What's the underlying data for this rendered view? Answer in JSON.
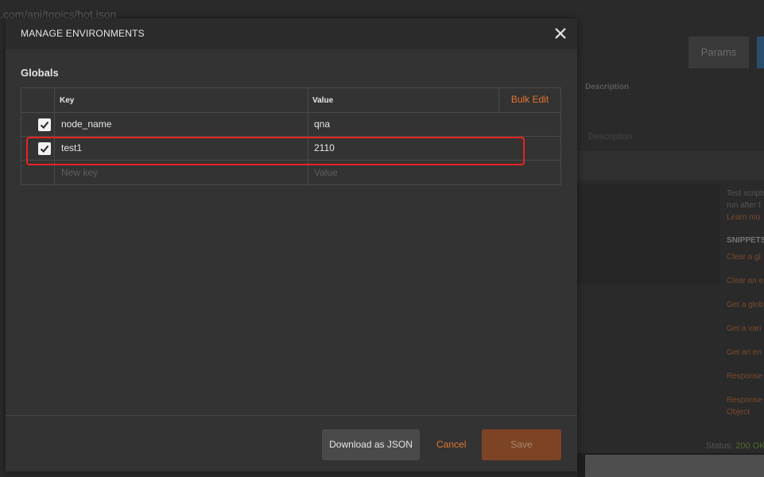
{
  "background": {
    "url": ".com/api/topics/hot.json",
    "params_label": "Params",
    "description_header": "Description",
    "description_placeholder": "Description",
    "sidebar_lines": [
      "Test scripts",
      "run after t",
      "Learn mo"
    ],
    "snippets_label": "SNIPPETS",
    "snippet_links": [
      "Clear a gl",
      "Clear an e",
      "Get a glob",
      "Get a vari",
      "Get an en",
      "Response",
      "Response Object"
    ],
    "status_label": "Status:",
    "status_value": "200 OK"
  },
  "modal": {
    "title": "MANAGE ENVIRONMENTS",
    "close_icon": "close-icon",
    "section_title": "Globals",
    "table": {
      "header_key": "Key",
      "header_value": "Value",
      "bulk_edit_label": "Bulk Edit",
      "rows": [
        {
          "enabled": true,
          "key": "node_name",
          "value": "qna"
        },
        {
          "enabled": true,
          "key": "test1",
          "value": "2110"
        }
      ],
      "new_key_placeholder": "New key",
      "new_value_placeholder": "Value"
    },
    "footer": {
      "download_label": "Download as JSON",
      "cancel_label": "Cancel",
      "save_label": "Save"
    }
  },
  "colors": {
    "accent": "#e3742f",
    "save_bg": "#7d4325",
    "highlight": "#e8231f"
  }
}
